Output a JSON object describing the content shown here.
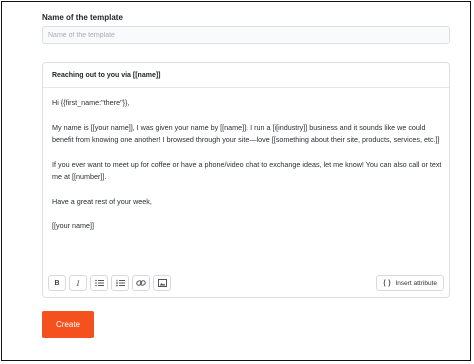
{
  "form": {
    "name_label": "Name of the template",
    "name_placeholder": "Name of the template"
  },
  "editor": {
    "subject": "Reaching out to you via [[name]]",
    "paragraphs": [
      "Hi {{first_name:\"there\"}},",
      "My name is [[your name]], I was given your name by [[name]]. I run a [i[industry]] business and it sounds like we could benefit from knowing one another! I browsed through your site—love [[something about their site, products, services, etc.]]",
      "If you ever want to meet up for coffee or have a phone/video chat to exchange ideas, let me know! You can also call or text me at [[number]].",
      "Have a great rest of your week,",
      "[[your name]]"
    ],
    "toolbar": {
      "bold_glyph": "B",
      "italic_glyph": "I",
      "insert_attribute_label": "Insert attribute"
    },
    "icons": [
      "bold-icon",
      "italic-icon",
      "bulleted-list-icon",
      "numbered-list-icon",
      "link-icon",
      "image-icon",
      "braces-icon"
    ]
  },
  "actions": {
    "create_label": "Create",
    "create_color": "#f4511e"
  }
}
